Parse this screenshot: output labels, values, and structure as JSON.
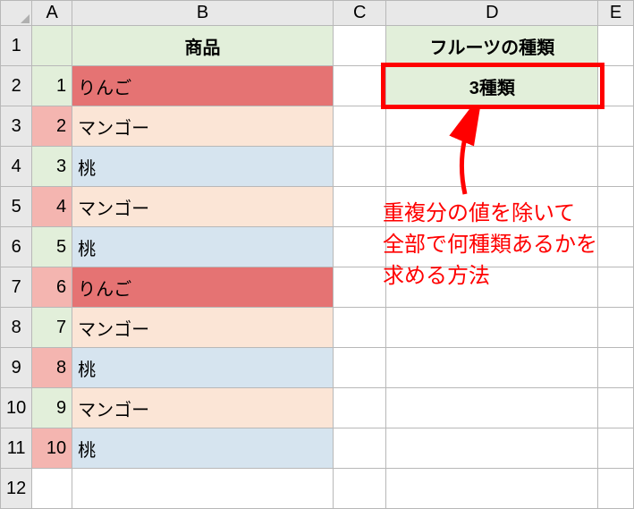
{
  "columns": [
    "A",
    "B",
    "C",
    "D",
    "E"
  ],
  "row_headers": [
    "1",
    "2",
    "3",
    "4",
    "5",
    "6",
    "7",
    "8",
    "9",
    "10",
    "11",
    "12"
  ],
  "headers": {
    "b1": "商品",
    "d1": "フルーツの種類"
  },
  "result": {
    "d2": "3種類"
  },
  "rows": [
    {
      "n": "1",
      "item": "りんご",
      "a_fill": "fill-green",
      "b_fill": "fill-red"
    },
    {
      "n": "2",
      "item": "マンゴー",
      "a_fill": "fill-pink",
      "b_fill": "fill-peach"
    },
    {
      "n": "3",
      "item": "桃",
      "a_fill": "fill-green",
      "b_fill": "fill-blue"
    },
    {
      "n": "4",
      "item": "マンゴー",
      "a_fill": "fill-pink",
      "b_fill": "fill-peach"
    },
    {
      "n": "5",
      "item": "桃",
      "a_fill": "fill-green",
      "b_fill": "fill-blue"
    },
    {
      "n": "6",
      "item": "りんご",
      "a_fill": "fill-pink",
      "b_fill": "fill-red"
    },
    {
      "n": "7",
      "item": "マンゴー",
      "a_fill": "fill-green",
      "b_fill": "fill-peach"
    },
    {
      "n": "8",
      "item": "桃",
      "a_fill": "fill-pink",
      "b_fill": "fill-blue"
    },
    {
      "n": "9",
      "item": "マンゴー",
      "a_fill": "fill-green",
      "b_fill": "fill-peach"
    },
    {
      "n": "10",
      "item": "桃",
      "a_fill": "fill-pink",
      "b_fill": "fill-blue"
    }
  ],
  "annotation": {
    "line1": "重複分の値を除いて",
    "line2": "全部で何種類あるかを",
    "line3": "求める方法"
  },
  "chart_data": {
    "type": "table",
    "title": "商品 / フルーツの種類",
    "columns": [
      "#",
      "商品"
    ],
    "data": [
      [
        1,
        "りんご"
      ],
      [
        2,
        "マンゴー"
      ],
      [
        3,
        "桃"
      ],
      [
        4,
        "マンゴー"
      ],
      [
        5,
        "桃"
      ],
      [
        6,
        "りんご"
      ],
      [
        7,
        "マンゴー"
      ],
      [
        8,
        "桃"
      ],
      [
        9,
        "マンゴー"
      ],
      [
        10,
        "桃"
      ]
    ],
    "unique_count_label": "フルーツの種類",
    "unique_count": 3
  }
}
